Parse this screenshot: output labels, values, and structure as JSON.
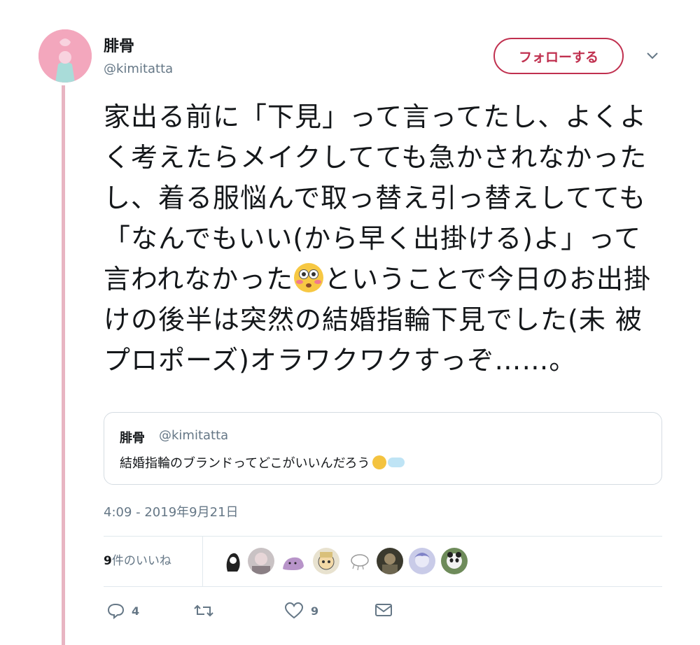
{
  "tweet": {
    "author_name": "腓骨",
    "author_handle": "@kimitatta",
    "follow_label": "フォローする",
    "text_part1": "家出る前に「下見」って言ってたし、よくよく考えたらメイクしてても急かされなかったし、着る服悩んで取っ替え引っ替えしてても「なんでもいい(から早く出掛ける)よ」って言われなかった",
    "emoji_inline": "flushed-face-emoji",
    "text_part2": "ということで今日のお出掛けの後半は突然の結婚指輪下見でした(未 被プロポーズ)オラワクワクすっぞ……。",
    "timestamp": "4:09 - 2019年9月21日"
  },
  "quoted_tweet": {
    "author_name": "腓骨",
    "author_handle": "@kimitatta",
    "text": "結婚指輪のブランドってどこがいいんだろう",
    "emojis": [
      "thinking-face-emoji",
      "thought-balloon-emoji"
    ]
  },
  "likes": {
    "count": "9",
    "suffix": "件のいいね",
    "avatars": [
      "liker-avatar-1",
      "liker-avatar-2",
      "liker-avatar-3",
      "liker-avatar-4",
      "liker-avatar-5",
      "liker-avatar-6",
      "liker-avatar-7",
      "liker-avatar-8"
    ]
  },
  "actions": {
    "reply_count": "4",
    "retweet_count": "",
    "like_count": "9"
  },
  "icons": {
    "chevron": "chevron-down-icon",
    "reply": "reply-icon",
    "retweet": "retweet-icon",
    "like": "heart-icon",
    "dm": "envelope-icon"
  },
  "colors": {
    "accent": "#c0304f",
    "thread_line": "#e8b5c2",
    "muted": "#657786"
  }
}
